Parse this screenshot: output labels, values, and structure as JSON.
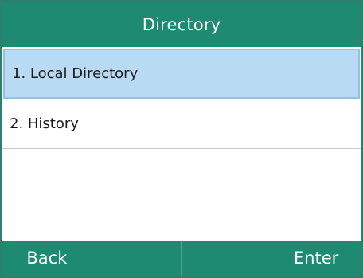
{
  "header": {
    "title": "Directory"
  },
  "menu": {
    "items": [
      {
        "label": "1. Local Directory",
        "selected": true
      },
      {
        "label": "2. History",
        "selected": false
      }
    ]
  },
  "softkeys": {
    "keys": [
      {
        "label": "Back"
      },
      {
        "label": ""
      },
      {
        "label": ""
      },
      {
        "label": "Enter"
      }
    ]
  },
  "colors": {
    "accent": "#1f8a72",
    "selection": "#b8daf2"
  }
}
